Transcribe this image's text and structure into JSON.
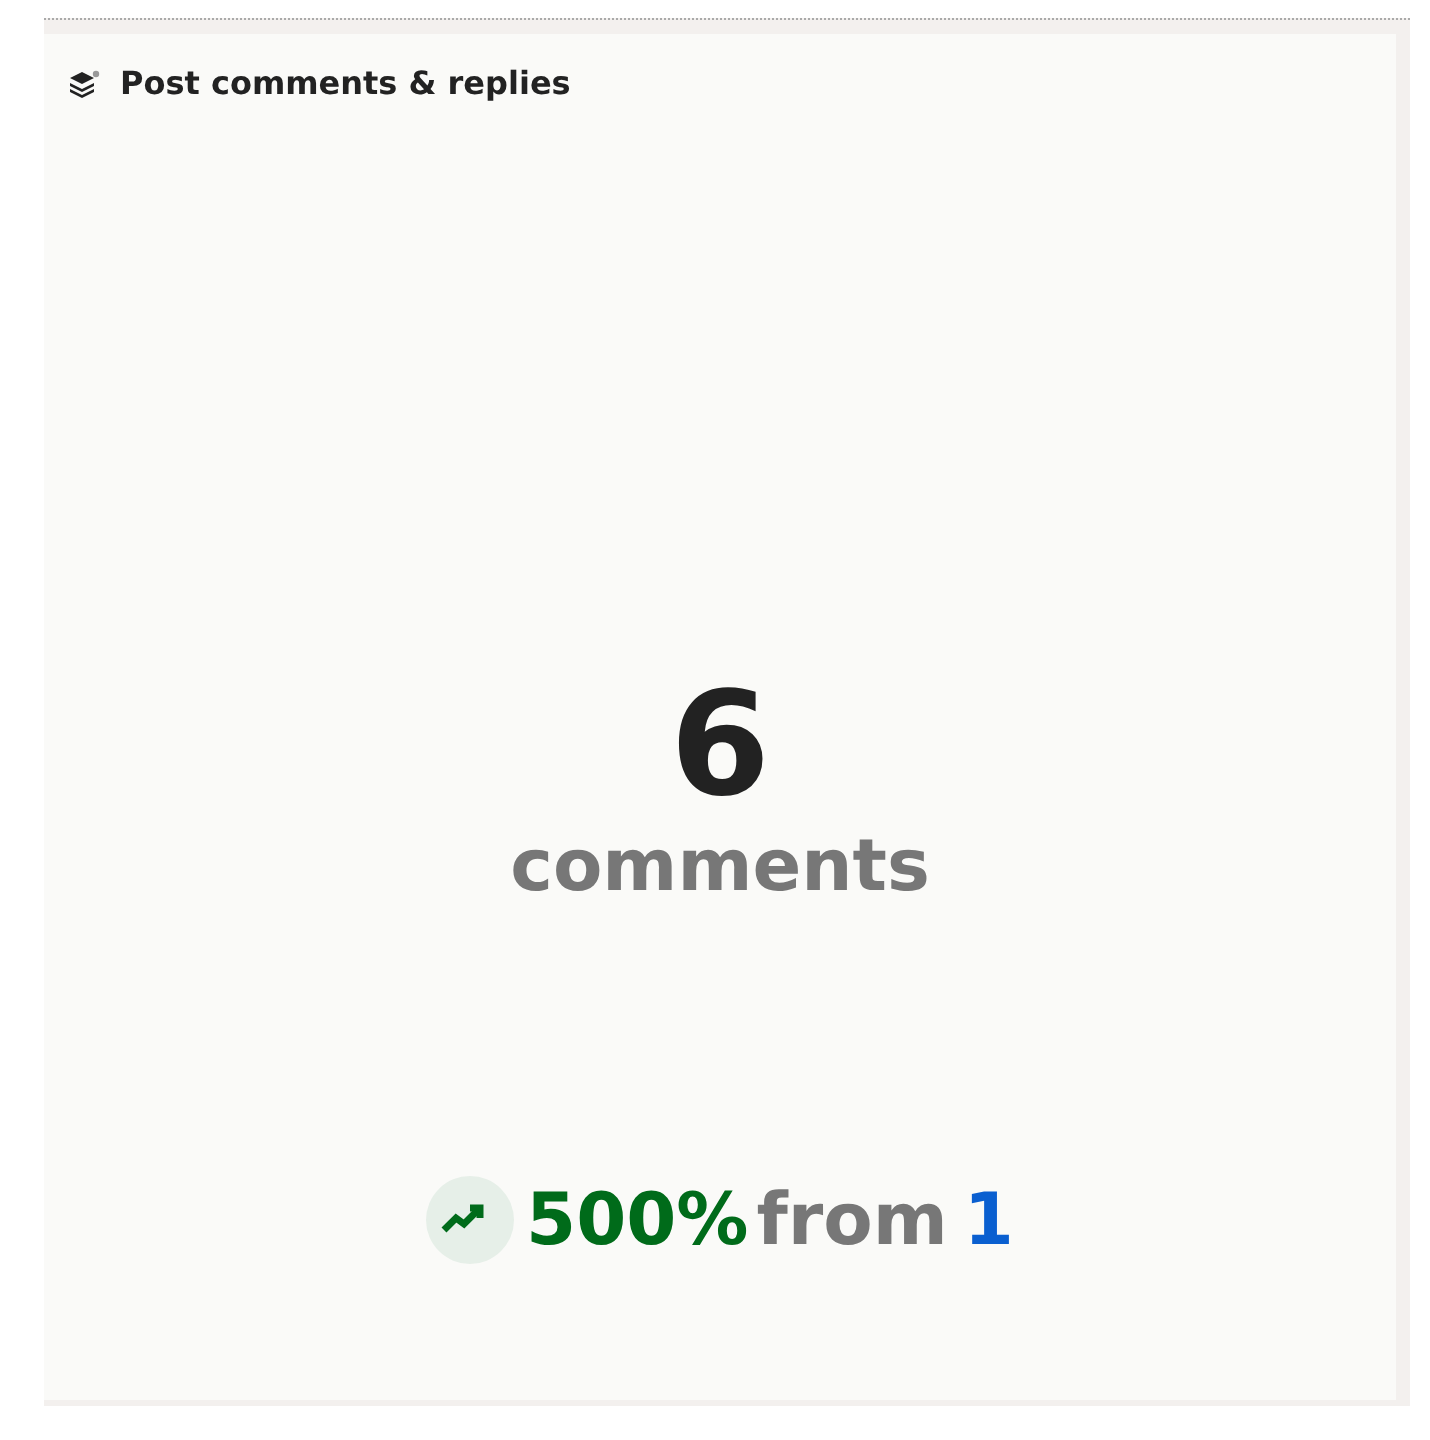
{
  "card": {
    "title": "Post comments & replies"
  },
  "metric": {
    "value": "6",
    "unit": "comments"
  },
  "change": {
    "increase": true,
    "percent": "500%",
    "from_label": "from",
    "previous": "1"
  }
}
